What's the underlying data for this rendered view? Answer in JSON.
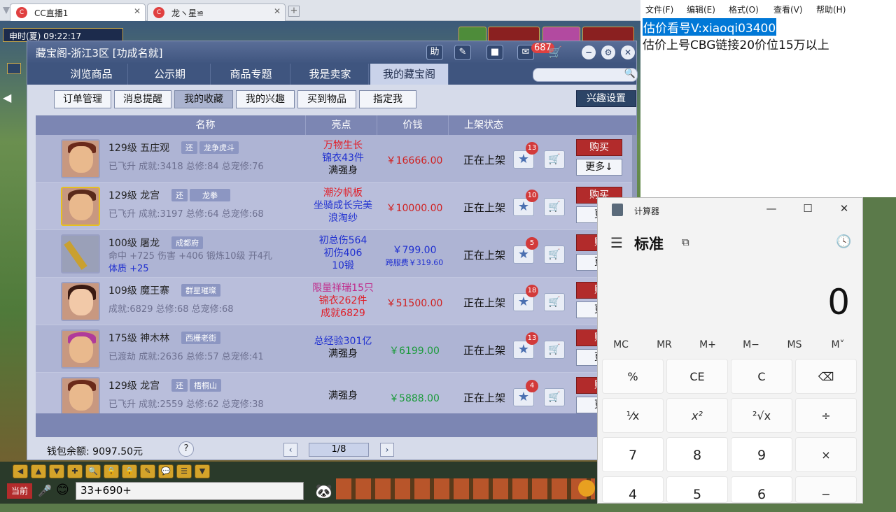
{
  "browser_tabs": [
    {
      "label": "CC直播1",
      "favicon": "cc-icon"
    },
    {
      "label": "龙ヽ星≌",
      "favicon": "cc-icon"
    }
  ],
  "game": {
    "clock": "申时(夏)  09:22:17",
    "chat_input": "33+690+",
    "current_label": "当前"
  },
  "window": {
    "title": "藏宝阁-浙江3区 [功成名就]",
    "help_label": "助",
    "message_count": "687",
    "tabs": [
      "浏览商品",
      "公示期",
      "商品专题",
      "我是卖家",
      "我的藏宝阁"
    ],
    "selected_tab": 4,
    "sub_buttons": [
      "订单管理",
      "消息提醒",
      "我的收藏",
      "我的兴趣",
      "买到物品",
      "指定我"
    ],
    "selected_sub": 2,
    "interest_setting": "兴趣设置",
    "columns": [
      "名称",
      "亮点",
      "价钱",
      "上架状态"
    ],
    "rows": [
      {
        "level_school": "129级  五庄观",
        "tag_flag": "还",
        "tag_server": "龙争虎斗",
        "stats": "已飞升 成就:3418 总修:84 总宠修:76",
        "hl1": "万物生长",
        "hl2": "锦衣43件",
        "hl3": "满强身",
        "price": "￥16666.00",
        "price_color": "red",
        "status": "正在上架",
        "stars": "13",
        "buy": "购买",
        "more": "更多↓"
      },
      {
        "level_school": "129级  龙宫",
        "tag_flag": "还",
        "tag_server": "龙拳",
        "stats": "已飞升 成就:3197 总修:64 总宠修:68",
        "hl1": "潮汐帆板",
        "hl2": "坐骑成长完美",
        "hl3": "浪淘纱",
        "price": "￥10000.00",
        "price_color": "red",
        "status": "正在上架",
        "stars": "10",
        "buy": "购买",
        "more": "更"
      },
      {
        "level_school": "100级  屠龙",
        "tag_flag": "",
        "tag_server": "成都府",
        "stats": "命中 +725 伤害 +406 锻炼10级 开4孔",
        "stats2": "体质 +25",
        "hl1": "初总伤564",
        "hl2": "初伤406",
        "hl3": "10锻",
        "price": "￥799.00",
        "price_sub": "跨服费￥319.60",
        "price_color": "blue",
        "status": "正在上架",
        "stars": "5",
        "buy": "购",
        "more": "更"
      },
      {
        "level_school": "109级  魔王寨",
        "tag_flag": "",
        "tag_server": "群星璀璨",
        "stats": "成就:6829 总修:68 总宠修:68",
        "hl1": "限量祥瑞15只",
        "hl2": "锦衣262件",
        "hl3": "成就6829",
        "price": "￥51500.00",
        "price_color": "red",
        "status": "正在上架",
        "stars": "18",
        "buy": "购",
        "more": "更"
      },
      {
        "level_school": "175级  神木林",
        "tag_flag": "",
        "tag_server": "西栅老街",
        "stats": "已渡劫 成就:2636 总修:57 总宠修:41",
        "hl1": "总经验301亿",
        "hl2": "满强身",
        "hl3": "",
        "price": "￥6199.00",
        "price_color": "green",
        "status": "正在上架",
        "stars": "13",
        "buy": "购",
        "more": "更"
      },
      {
        "level_school": "129级  龙宫",
        "tag_flag": "还",
        "tag_server": "梧桐山",
        "stats": "已飞升 成就:2559 总修:62 总宠修:38",
        "hl1": "满强身",
        "hl2": "",
        "hl3": "",
        "price": "￥5888.00",
        "price_color": "green",
        "status": "正在上架",
        "stars": "4",
        "buy": "购",
        "more": "更"
      }
    ],
    "wallet": "钱包余额: 9097.50元",
    "page": "1/8"
  },
  "notepad": {
    "menu": [
      "文件(F)",
      "编辑(E)",
      "格式(O)",
      "查看(V)",
      "帮助(H)"
    ],
    "line1": "估价看号V:xiaoqi03400",
    "line2": "估价上号CBG链接20价位15万以上"
  },
  "calculator": {
    "title": "计算器",
    "mode": "标准",
    "display": "0",
    "memory": [
      "MC",
      "MR",
      "M+",
      "M−",
      "MS",
      "M˅"
    ],
    "keys": [
      [
        "%",
        "CE",
        "C",
        "⌫"
      ],
      [
        "¹⁄x",
        "x²",
        "²√x",
        "÷"
      ],
      [
        "7",
        "8",
        "9",
        "×"
      ],
      [
        "4",
        "5",
        "6",
        "−"
      ]
    ]
  }
}
